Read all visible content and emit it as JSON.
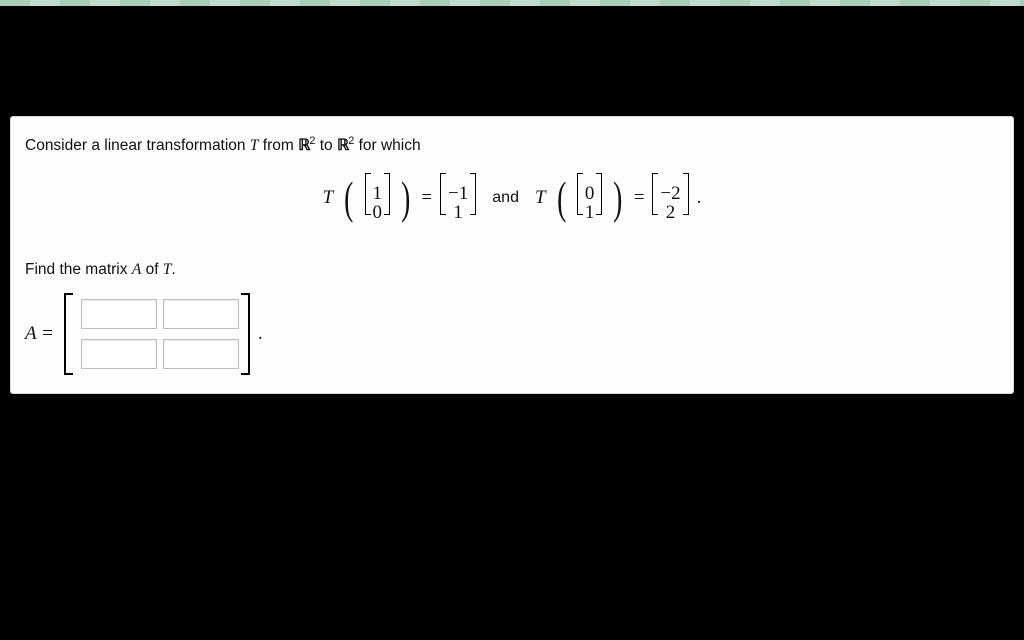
{
  "problem": {
    "intro_prefix": "Consider a linear transformation ",
    "T_sym": "T",
    "intro_mid1": " from ",
    "R_sym": "ℝ",
    "sup2": "2",
    "intro_mid2": " to ",
    "intro_suffix": " for which",
    "eqn": {
      "T": "T",
      "v1_top": "1",
      "v1_bot": "0",
      "r1_top": "−1",
      "r1_bot": "1",
      "and": "and",
      "v2_top": "0",
      "v2_bot": "1",
      "r2_top": "−2",
      "r2_bot": "2",
      "eq": "=",
      "period": "."
    },
    "find_prefix": "Find the matrix ",
    "A_sym": "A",
    "find_mid": " of ",
    "find_suffix": ".",
    "answer_label": "A =",
    "answer_period": "."
  },
  "inputs": {
    "a11": "",
    "a12": "",
    "a21": "",
    "a22": ""
  }
}
